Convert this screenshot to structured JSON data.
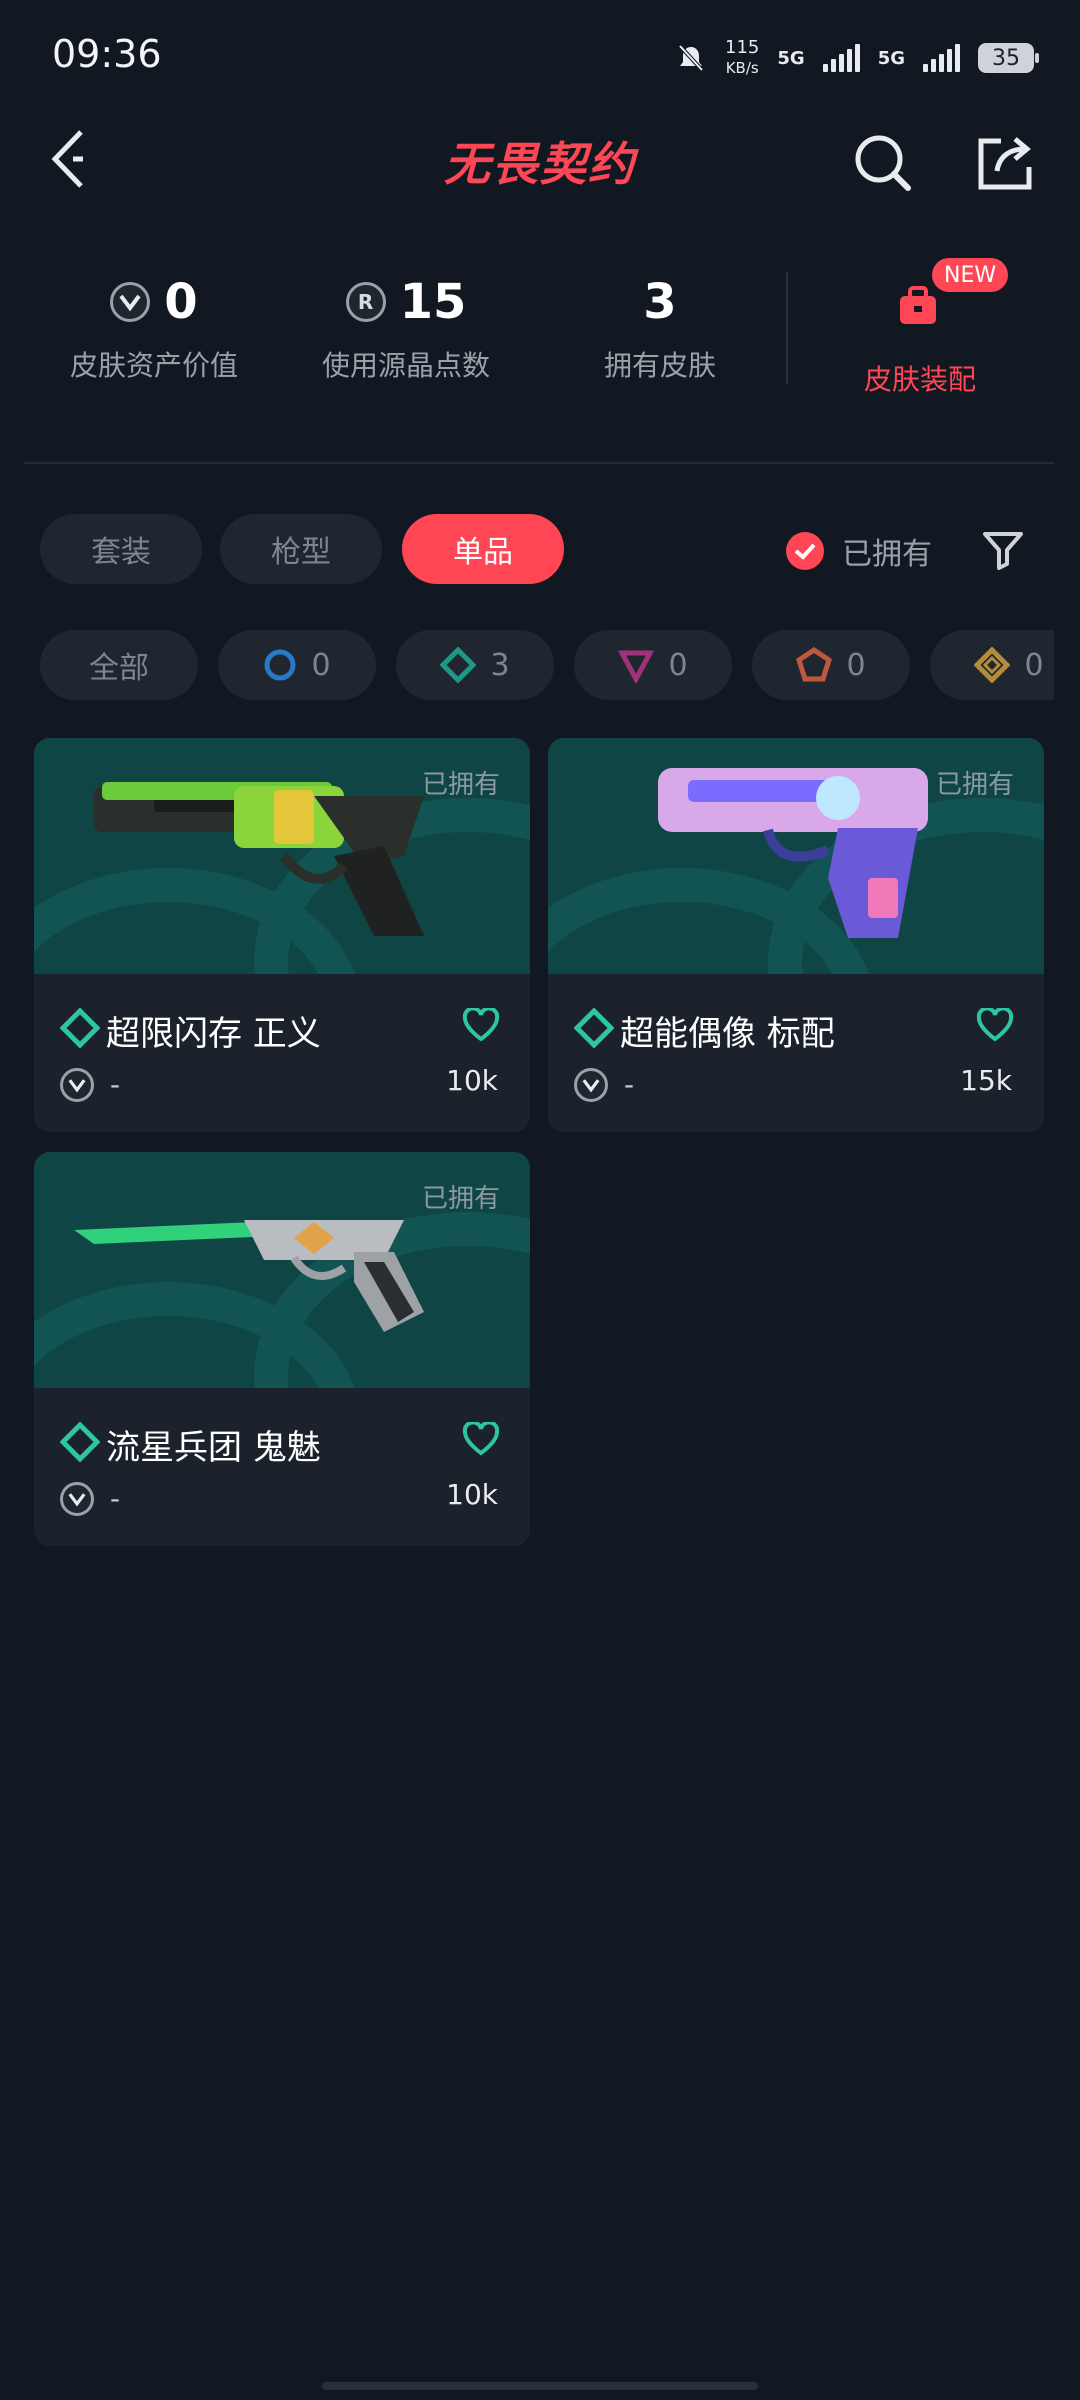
{
  "status": {
    "time": "09:36",
    "speed_value": "115",
    "speed_unit": "KB/s",
    "net1": "5G",
    "net2": "5G",
    "battery": "35"
  },
  "header": {
    "title": "无畏契约"
  },
  "stats": [
    {
      "value": "0",
      "label": "皮肤资产价值"
    },
    {
      "value": "15",
      "label": "使用源晶点数"
    },
    {
      "value": "3",
      "label": "拥有皮肤"
    }
  ],
  "equip": {
    "label": "皮肤装配",
    "badge": "NEW"
  },
  "tabs": [
    {
      "label": "套装"
    },
    {
      "label": "枪型"
    },
    {
      "label": "单品"
    }
  ],
  "owned_filter": {
    "label": "已拥有"
  },
  "tiers": {
    "all": "全部",
    "counts": [
      "0",
      "3",
      "0",
      "0",
      "0"
    ]
  },
  "cards": [
    {
      "name": "超限闪存 正义",
      "owned": "已拥有",
      "price": "-",
      "value": "10k"
    },
    {
      "name": "超能偶像 标配",
      "owned": "已拥有",
      "price": "-",
      "value": "15k"
    },
    {
      "name": "流星兵团 鬼魅",
      "owned": "已拥有",
      "price": "-",
      "value": "10k"
    }
  ],
  "colors": {
    "accent": "#ff4655",
    "background": "#121821",
    "card": "#1c222b",
    "tier_teal": "#2ec4a6"
  }
}
